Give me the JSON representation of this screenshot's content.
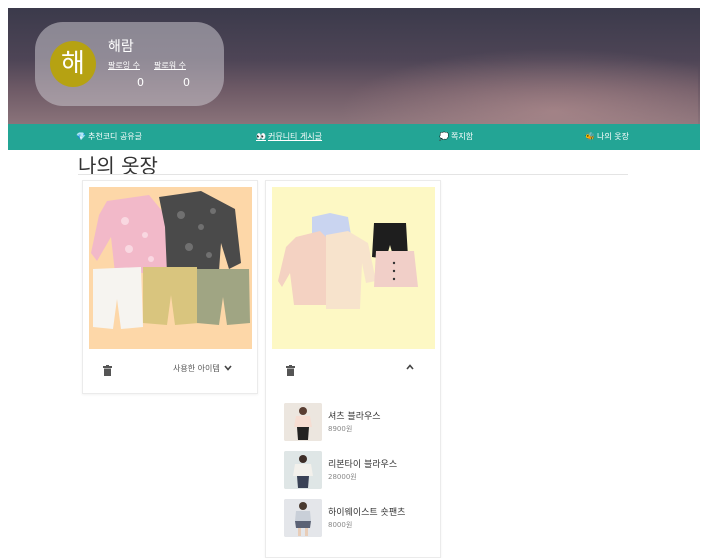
{
  "profile": {
    "avatar_initial": "해",
    "username": "해람",
    "following_label": "팔로잉 수",
    "follower_label": "팔로워 수",
    "following_count": "0",
    "follower_count": "0"
  },
  "nav": {
    "items": [
      {
        "icon": "💎",
        "label": "추천코디 공유글"
      },
      {
        "icon": "👀",
        "label": "커뮤니티 게시글"
      },
      {
        "icon": "💭",
        "label": "쪽지함"
      },
      {
        "icon": "🐝",
        "label": "나의 옷장"
      }
    ]
  },
  "page": {
    "title": "나의 옷장"
  },
  "cards": [
    {
      "toggle_label": "사용한 아이템",
      "expanded": false
    },
    {
      "toggle_label": "",
      "expanded": true,
      "items": [
        {
          "name": "셔츠 블라우스",
          "price": "8900원"
        },
        {
          "name": "리본타이 블라우스",
          "price": "28000원"
        },
        {
          "name": "하이웨이스트 숏팬츠",
          "price": "8000원"
        }
      ]
    }
  ],
  "colors": {
    "nav_bg": "#23a595",
    "avatar_bg": "#b6a212",
    "card1_bg": "#fdd7a8",
    "card2_bg": "#fdf8c4"
  }
}
